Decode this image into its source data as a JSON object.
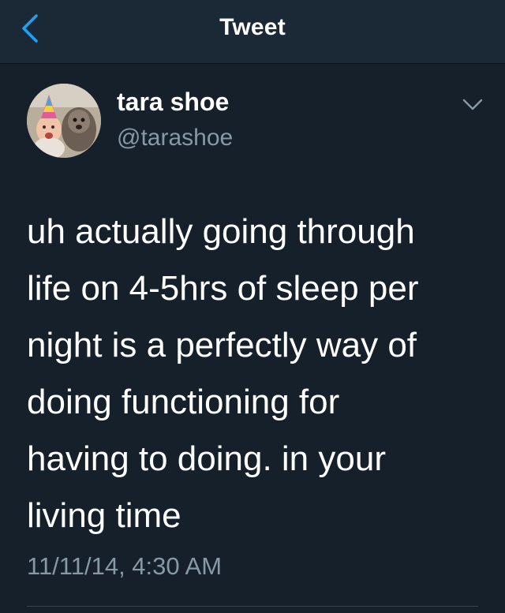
{
  "nav": {
    "title": "Tweet",
    "back_icon": "chevron-left-icon"
  },
  "author": {
    "display_name": "tara shoe",
    "handle": "@tarashoe",
    "avatar_icon": "profile-avatar"
  },
  "tweet": {
    "lines": [
      "uh actually going through",
      "life on 4-5hrs of sleep per",
      "night is a perfectly way of",
      "doing functioning for",
      "having to doing. in your",
      "living time"
    ],
    "timestamp": "11/11/14, 4:30 AM",
    "menu_icon": "chevron-down-icon"
  },
  "colors": {
    "background": "#15202b",
    "navbar": "#1b2836",
    "accent": "#1da1f2",
    "secondary_text": "#8899a6"
  }
}
